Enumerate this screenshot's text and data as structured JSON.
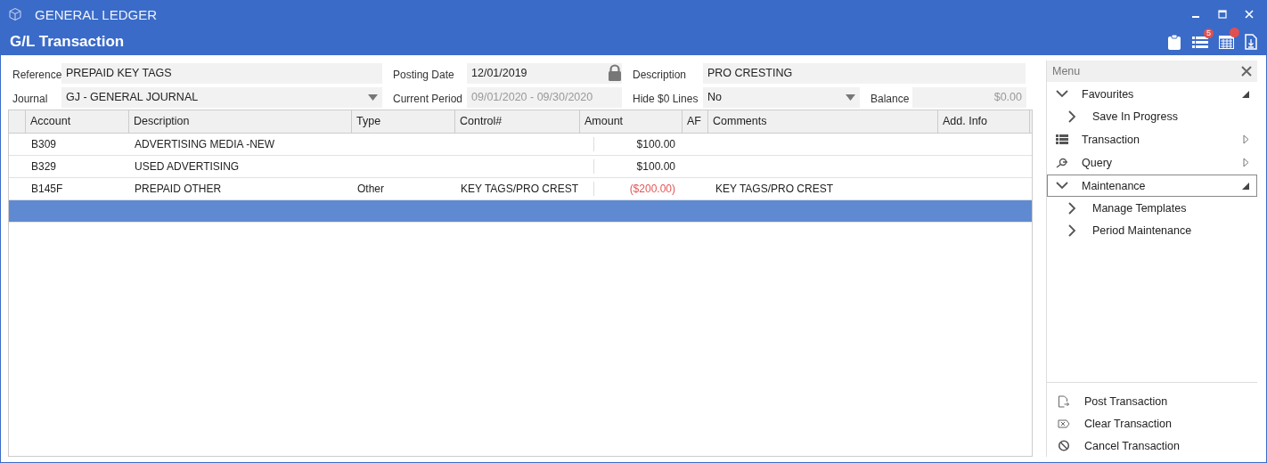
{
  "window": {
    "app_title": "GENERAL LEDGER",
    "title": "G/L Transaction"
  },
  "toolbar": [
    {
      "kind": "clipboard"
    },
    {
      "kind": "list",
      "badge": "5"
    },
    {
      "kind": "calendar",
      "alert": true
    },
    {
      "kind": "document"
    }
  ],
  "form": {
    "rows": [
      [
        {
          "label": "Reference",
          "value": "PREPAID KEY TAGS",
          "kind": "text"
        },
        {
          "label": "Posting Date",
          "value": "12/01/2019",
          "kind": "locked"
        },
        {
          "label": "Description",
          "value": "PRO CRESTING",
          "kind": "text"
        }
      ],
      [
        {
          "label": "Journal",
          "value": "GJ - GENERAL JOURNAL",
          "kind": "dropdown"
        },
        {
          "label": "Current Period",
          "value": "09/01/2020 - 09/30/2020",
          "kind": "readonly"
        },
        {
          "label": "Hide $0 Lines",
          "value": "No",
          "kind": "dropdown"
        },
        {
          "label": "Balance",
          "value": "$0.00",
          "kind": "readonly"
        }
      ]
    ]
  },
  "table": {
    "columns": [
      "Account",
      "Description",
      "Type",
      "Control#",
      "Amount",
      "AF",
      "Comments",
      "Add. Info"
    ],
    "rows": [
      {
        "selected": false,
        "account": "B309",
        "description": "ADVERTISING MEDIA    -NEW",
        "amount": "$100.00",
        "negative": false
      },
      {
        "selected": false,
        "account": "B329",
        "description": "USED ADVERTISING",
        "amount": "$100.00",
        "negative": false
      },
      {
        "selected": false,
        "account": "B145F",
        "description": "PREPAID OTHER",
        "type": "Other",
        "control": "KEY TAGS/PRO CREST",
        "amount": "($200.00)",
        "negative": true,
        "comments": "KEY TAGS/PRO CREST"
      },
      {
        "selected": true
      }
    ]
  },
  "menu": {
    "title": "Menu",
    "items": [
      {
        "label": "Favourites",
        "expanded": true,
        "selected": false,
        "children": [
          {
            "label": "Save In Progress"
          }
        ]
      },
      {
        "label": "Transaction",
        "expanded": false,
        "selected": false
      },
      {
        "label": "Query",
        "expanded": false,
        "selected": false
      },
      {
        "label": "Maintenance",
        "expanded": true,
        "selected": true,
        "children": [
          {
            "label": "Manage Templates"
          },
          {
            "label": "Period Maintenance"
          }
        ]
      }
    ],
    "actions": [
      {
        "label": "Post Transaction",
        "kind": "post"
      },
      {
        "label": "Clear Transaction",
        "kind": "clear"
      },
      {
        "label": "Cancel Transaction",
        "kind": "cancel"
      }
    ]
  }
}
